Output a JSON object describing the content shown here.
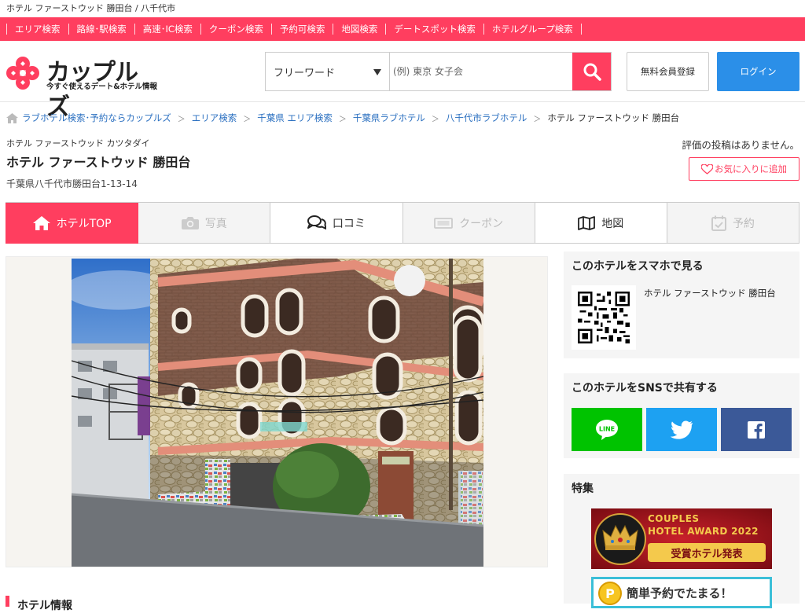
{
  "page": {
    "title": "ホテル ファーストウッド 勝田台 / 八千代市"
  },
  "nav": {
    "items": [
      "エリア検索",
      "路線･駅検索",
      "高速･IC検索",
      "クーポン検索",
      "予約可検索",
      "地図検索",
      "デートスポット検索",
      "ホテルグループ検索"
    ]
  },
  "brand": {
    "name": "カップルズ",
    "tagline": "今すぐ使えるデート&ホテル情報",
    "accent": "#ff3e5f",
    "blue": "#2b8fe8"
  },
  "search": {
    "select_label": "フリーワード",
    "placeholder": "(例) 東京 女子会"
  },
  "header": {
    "register_label": "無料会員登録",
    "login_label": "ログイン"
  },
  "breadcrumb": {
    "items": [
      "ラブホテル検索･予約ならカップルズ",
      "エリア検索",
      "千葉県 エリア検索",
      "千葉県ラブホテル",
      "八千代市ラブホテル"
    ],
    "current": "ホテル ファーストウッド 勝田台"
  },
  "hotel": {
    "kana": "ホテル ファーストウッド カツタダイ",
    "name": "ホテル ファーストウッド 勝田台",
    "address": "千葉県八千代市勝田台1-13-14",
    "review_note": "評価の投稿はありません。",
    "fav_label": "お気に入りに追加"
  },
  "tabs": [
    {
      "label": "ホテルTOP",
      "icon": "home-icon",
      "state": "active"
    },
    {
      "label": "写真",
      "icon": "camera-icon",
      "state": "disabled"
    },
    {
      "label": "口コミ",
      "icon": "comments-icon",
      "state": "normal"
    },
    {
      "label": "クーポン",
      "icon": "ticket-icon",
      "state": "disabled"
    },
    {
      "label": "地図",
      "icon": "map-icon",
      "state": "normal"
    },
    {
      "label": "予約",
      "icon": "calendar-check-icon",
      "state": "disabled"
    }
  ],
  "main": {
    "section_title": "ホテル情報"
  },
  "side": {
    "qr_title": "このホテルをスマホで見る",
    "qr_name": "ホテル ファーストウッド 勝田台",
    "sns_title": "このホテルをSNSで共有する",
    "sns": [
      {
        "name": "LINE",
        "color": "#00c300"
      },
      {
        "name": "twitter",
        "color": "#1da1f2"
      },
      {
        "name": "facebook",
        "color": "#3b5998"
      }
    ],
    "feature_title": "特集",
    "banner1": {
      "line1": "COUPLES",
      "line2": "HOTEL AWARD 2022",
      "line3": "受賞ホテル発表"
    },
    "banner2": {
      "text": "簡単予約でたまる！"
    }
  }
}
